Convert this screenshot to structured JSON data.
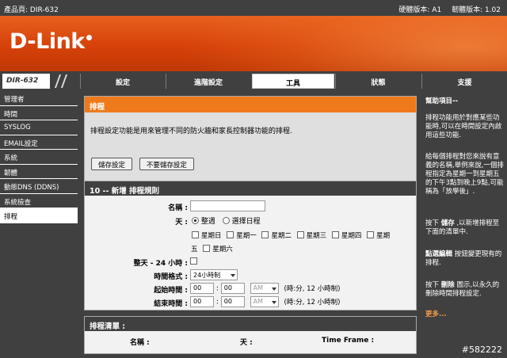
{
  "topbar": {
    "product_page": "產品頁: DIR-632",
    "hardware_version": "硬體版本: A1",
    "firmware_version": "韌體版本: 1.02"
  },
  "brand": {
    "logo_text": "D-Link"
  },
  "nav": {
    "model": "DIR-632",
    "tabs": [
      {
        "label": "設定",
        "active": false
      },
      {
        "label": "進階設定",
        "active": false
      },
      {
        "label": "工具",
        "active": true
      },
      {
        "label": "狀態",
        "active": false
      },
      {
        "label": "支援",
        "active": false
      }
    ]
  },
  "sidebar": {
    "items": [
      {
        "label": "管理者"
      },
      {
        "label": "時間"
      },
      {
        "label": "SYSLOG"
      },
      {
        "label": "EMAIL設定"
      },
      {
        "label": "系統"
      },
      {
        "label": "韌體"
      },
      {
        "label": "動態DNS (DDNS)"
      },
      {
        "label": "系統檢查"
      },
      {
        "label": "排程"
      }
    ],
    "active_index": 8
  },
  "schedule": {
    "title": "排程",
    "description": "排程設定功能是用來管理不同的防火牆和家長控制器功能的排程.",
    "save_button": "儲存設定",
    "nosave_button": "不要儲存設定"
  },
  "rule": {
    "header": "10 -- 新增 排程規則",
    "name_label": "名稱 :",
    "name_value": "",
    "day_label": "天 :",
    "all_week": "整週",
    "select_days": "選擇日程",
    "days_line1": [
      "星期日",
      "星期一",
      "星期二",
      "星期三",
      "星期四",
      "星期"
    ],
    "days_line2_prefix": "五",
    "days_line2": [
      "星期六"
    ],
    "allday_label": "整天 - 24 小時 :",
    "format_label": "時間格式 :",
    "format_value": "24小時制",
    "start_label": "起始時間 :",
    "end_label": "結束時間 :",
    "start_hour": "00",
    "start_min": "00",
    "end_hour": "00",
    "end_min": "00",
    "ampm": "AM",
    "time_hint": "(時:分, 12 小時制)"
  },
  "list": {
    "header": "排程清單 :",
    "col_name": "名稱 :",
    "col_day": "天 :",
    "col_timeframe": "Time Frame :"
  },
  "help": {
    "title": "幫助項目--",
    "p1": "排程功能用於對應某些功能時,可以在時間設定內啟用這些功能.",
    "p2": "給每個排程對您來說有意義的名稱,舉例來說,一個排程指定為星期一到星期五的下午3點到晚上9點,可能稱為「放學後」.",
    "p3_pre": "按下",
    "p3_bold": "儲存",
    "p3_post": ",以新增排程至下面的清單中.",
    "p4_bold": "點選編輯",
    "p4_post": "按鈕變更現有的排程.",
    "p5_pre": "按下",
    "p5_bold": "刪除",
    "p5_post": "圖示,以永久的刪除時間排程設定.",
    "more": "更多..."
  },
  "watermark": "#582222"
}
